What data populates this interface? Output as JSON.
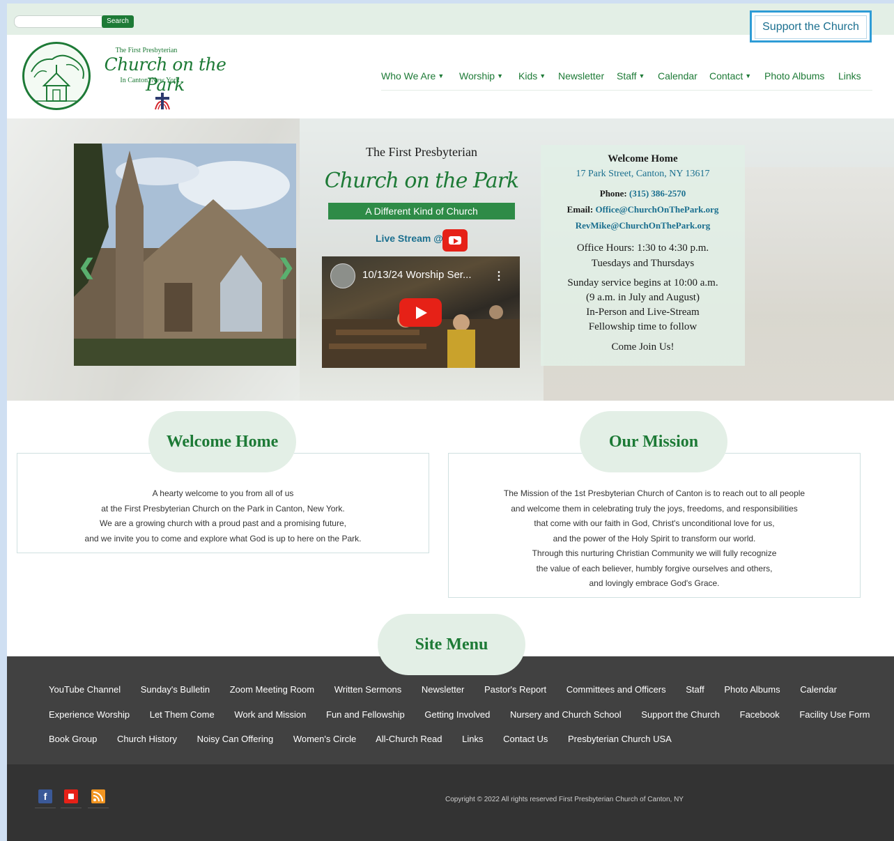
{
  "topbar": {
    "search_placeholder": "",
    "search_label": "Search",
    "support_label": "Support the Church"
  },
  "logo": {
    "top": "The First Presbyterian",
    "main": "Church on the Park",
    "sub": "In Canton, New York"
  },
  "nav": [
    {
      "label": "Who We Are",
      "dropdown": true
    },
    {
      "label": "Worship",
      "dropdown": true
    },
    {
      "label": "Kids",
      "dropdown": true
    },
    {
      "label": "Newsletter",
      "dropdown": false
    },
    {
      "label": "Staff",
      "dropdown": true
    },
    {
      "label": "Calendar",
      "dropdown": false
    },
    {
      "label": "Contact",
      "dropdown": true
    },
    {
      "label": "Photo Albums",
      "dropdown": false
    },
    {
      "label": "Links",
      "dropdown": false
    }
  ],
  "hero": {
    "title": "The First Presbyterian",
    "script_title": "Church on the Park",
    "tagline": "A Different Kind of Church",
    "livestream_label": "Live Stream @",
    "video_title": "10/13/24 Worship Ser...",
    "info": {
      "heading": "Welcome Home",
      "address": "17 Park Street, Canton, NY 13617",
      "phone_label": "Phone:",
      "phone": "(315) 386-2570",
      "email_label": "Email:",
      "email": "Office@ChurchOnThePark.org",
      "email2": "RevMike@ChurchOnThePark.org",
      "office_hours": "Office Hours: 1:30 to 4:30 p.m.",
      "office_days": "Tuesdays and Thursdays",
      "sunday_1": "Sunday service begins at 10:00 a.m.",
      "sunday_2": "(9 a.m. in July and August)",
      "sunday_3": "In-Person and Live-Stream",
      "sunday_4": "Fellowship time to follow",
      "cta": "Come Join Us!"
    }
  },
  "welcome": {
    "title": "Welcome Home",
    "lines": [
      "A hearty welcome to you from all of us",
      "at the First Presbyterian Church on the Park in Canton, New York.",
      "We are a growing church with a proud past and a promising future,",
      "and we invite you to come and explore what God is up to here on the Park."
    ]
  },
  "mission": {
    "title": "Our Mission",
    "lines": [
      "The Mission of the 1st Presbyterian Church of Canton is to reach out to all people",
      "and welcome them in celebrating truly the joys, freedoms, and responsibilities",
      "that come with our faith in God, Christ's unconditional love for us,",
      "and the power of the Holy Spirit to transform our world.",
      "Through this nurturing Christian Community we will fully recognize",
      "the value of each believer, humbly forgive ourselves and others,",
      "and lovingly embrace God's Grace."
    ]
  },
  "site_menu": {
    "title": "Site Menu",
    "rows": [
      [
        "YouTube Channel",
        "Sunday's Bulletin",
        "Zoom Meeting Room",
        "Written Sermons",
        "Newsletter",
        "Pastor's Report",
        "Committees and Officers",
        "Staff",
        "Photo Albums",
        "Calendar"
      ],
      [
        "Experience Worship",
        "Let Them Come",
        "Work and Mission",
        "Fun and Fellowship",
        "Getting Involved",
        "Nursery and Church School",
        "Support the Church",
        "Facebook",
        "Facility Use Form"
      ],
      [
        "Book Group",
        "Church History",
        "Noisy Can Offering",
        "Women's Circle",
        "All-Church Read",
        "Links",
        "Contact Us",
        "Presbyterian Church USA"
      ]
    ]
  },
  "footer": {
    "social": [
      "facebook-icon",
      "youtube-icon",
      "rss-icon"
    ],
    "copyright": "Copyright © 2022 All rights reserved First Presbyterian Church of Canton, NY"
  },
  "colors": {
    "brand_green": "#1d7a36",
    "link_blue": "#1a6f8f",
    "pill_bg": "#e3efe6",
    "footer_bg": "#414141"
  }
}
